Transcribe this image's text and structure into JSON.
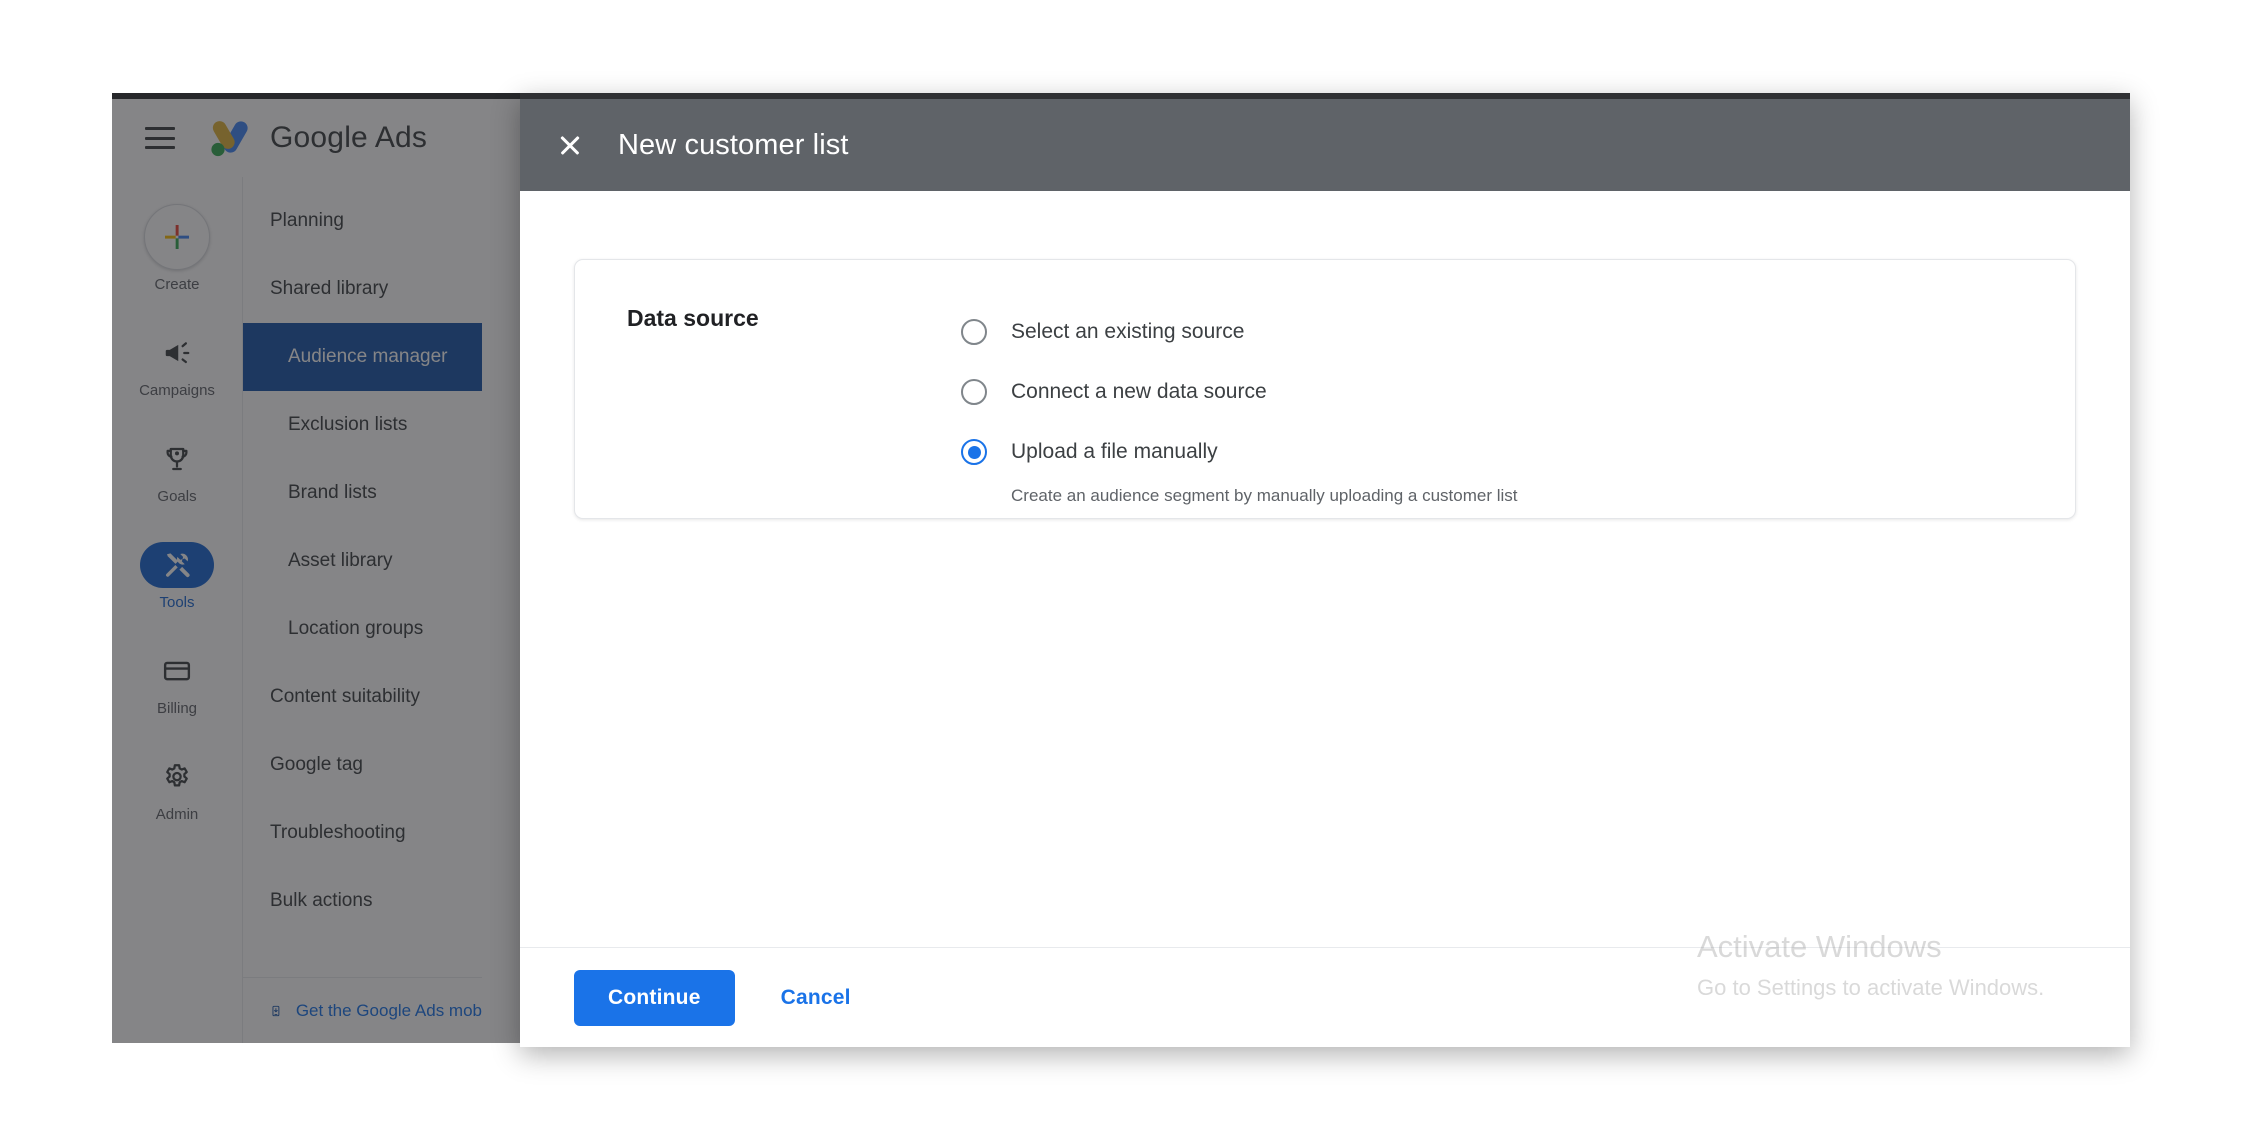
{
  "app": {
    "brand": "Google Ads",
    "menu_icon": "hamburger-icon",
    "rail": [
      {
        "label": "Create",
        "icon": "plus-icon",
        "active": false
      },
      {
        "label": "Campaigns",
        "icon": "megaphone-icon",
        "active": false
      },
      {
        "label": "Goals",
        "icon": "trophy-icon",
        "active": false
      },
      {
        "label": "Tools",
        "icon": "tools-icon",
        "active": true
      },
      {
        "label": "Billing",
        "icon": "credit-card-icon",
        "active": false
      },
      {
        "label": "Admin",
        "icon": "gear-icon",
        "active": false
      }
    ],
    "nav": [
      {
        "label": "Planning",
        "level": 1,
        "selected": false
      },
      {
        "label": "Shared library",
        "level": 1,
        "selected": false
      },
      {
        "label": "Audience manager",
        "level": 2,
        "selected": true
      },
      {
        "label": "Exclusion lists",
        "level": 2,
        "selected": false
      },
      {
        "label": "Brand lists",
        "level": 2,
        "selected": false
      },
      {
        "label": "Asset library",
        "level": 2,
        "selected": false
      },
      {
        "label": "Location groups",
        "level": 2,
        "selected": false
      },
      {
        "label": "Content suitability",
        "level": 1,
        "selected": false
      },
      {
        "label": "Google tag",
        "level": 1,
        "selected": false
      },
      {
        "label": "Troubleshooting",
        "level": 1,
        "selected": false
      },
      {
        "label": "Bulk actions",
        "level": 1,
        "selected": false
      }
    ],
    "nav_footer": {
      "label": "Get the Google Ads mob",
      "icon": "mobile-download-icon"
    }
  },
  "modal": {
    "title": "New customer list",
    "close_icon": "close-icon",
    "form": {
      "section_label": "Data source",
      "options": [
        {
          "label": "Select an existing source",
          "selected": false
        },
        {
          "label": "Connect a new data source",
          "selected": false
        },
        {
          "label": "Upload a file manually",
          "selected": true
        }
      ],
      "selected_help": "Create an audience segment by manually uploading a customer list"
    },
    "footer": {
      "primary": "Continue",
      "secondary": "Cancel"
    }
  },
  "watermark": {
    "title": "Activate Windows",
    "subtitle": "Go to Settings to activate Windows."
  },
  "colors": {
    "accent_blue": "#1a73e8",
    "nav_selected": "#1a56a8",
    "modal_header": "#5f6368"
  }
}
